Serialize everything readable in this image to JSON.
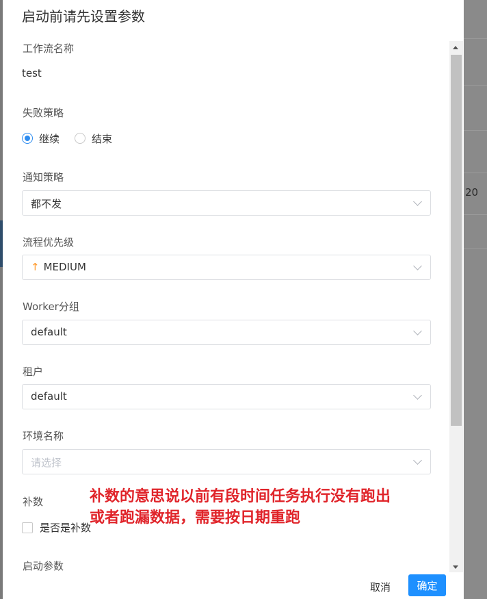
{
  "background": {
    "cell_text": "20"
  },
  "modal": {
    "title": "启动前请先设置参数",
    "workflow_name_label": "工作流名称",
    "workflow_name_value": "test",
    "failure_strategy_label": "失败策略",
    "failure_options": [
      "继续",
      "结束"
    ],
    "failure_selected": "继续",
    "notify_strategy_label": "通知策略",
    "notify_strategy_value": "都不发",
    "priority_label": "流程优先级",
    "priority_value": "MEDIUM",
    "priority_icon": "arrow-up-icon",
    "priority_color": "#ff9a2e",
    "worker_group_label": "Worker分组",
    "worker_group_value": "default",
    "tenant_label": "租户",
    "tenant_value": "default",
    "env_label": "环境名称",
    "env_placeholder": "请选择",
    "complement_label": "补数",
    "complement_checkbox_label": "是否是补数",
    "startup_params_label": "启动参数",
    "cancel_label": "取消",
    "confirm_label": "确定",
    "accent_color": "#2d8cf0"
  },
  "annotation": {
    "line1": "补数的意思说以前有段时间任务执行没有跑出",
    "line2": "或者跑漏数据，需要按日期重跑",
    "color": "#e0242a"
  }
}
